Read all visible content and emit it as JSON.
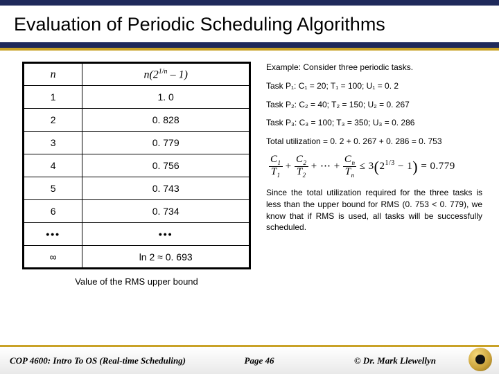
{
  "title": "Evaluation of Periodic Scheduling Algorithms",
  "table": {
    "head_n": "n",
    "head_fn_prefix": "n(2",
    "head_fn_exp": "1/n",
    "head_fn_suffix": " – 1)",
    "rows": [
      {
        "n": "1",
        "v": "1. 0"
      },
      {
        "n": "2",
        "v": "0. 828"
      },
      {
        "n": "3",
        "v": "0. 779"
      },
      {
        "n": "4",
        "v": "0. 756"
      },
      {
        "n": "5",
        "v": "0. 743"
      },
      {
        "n": "6",
        "v": "0. 734"
      },
      {
        "n": "•••",
        "v": "•••"
      },
      {
        "n": "∞",
        "v": "ln 2 ≈ 0. 693"
      }
    ],
    "caption": "Value of the RMS upper bound"
  },
  "example": {
    "intro": "Example:  Consider three periodic tasks.",
    "task1": "Task P₁: C₁ = 20; T₁ = 100; U₁ = 0. 2",
    "task2": "Task P₂: C₂ = 40; T₂ = 150; U₂ = 0. 267",
    "task3": "Task P₃: C₃ = 100; T₃ = 350; U₃ = 0. 286",
    "total": "Total utilization = 0. 2 + 0. 267 + 0. 286 = 0. 753",
    "conclusion": "Since the total utilization required for the three tasks is less than the upper bound for RMS (0. 753 < 0. 779), we know that if RMS is used, all tasks will be successfully scheduled."
  },
  "formula": {
    "result": "= 0.779"
  },
  "footer": {
    "course": "COP 4600: Intro To OS  (Real-time Scheduling)",
    "page": "Page 46",
    "author": "© Dr. Mark Llewellyn"
  },
  "chart_data": {
    "type": "table",
    "title": "Value of the RMS upper bound",
    "columns": [
      "n",
      "n(2^{1/n} - 1)"
    ],
    "rows": [
      [
        "1",
        1.0
      ],
      [
        "2",
        0.828
      ],
      [
        "3",
        0.779
      ],
      [
        "4",
        0.756
      ],
      [
        "5",
        0.743
      ],
      [
        "6",
        0.734
      ],
      [
        "...",
        "..."
      ],
      [
        "∞",
        0.693
      ]
    ]
  }
}
